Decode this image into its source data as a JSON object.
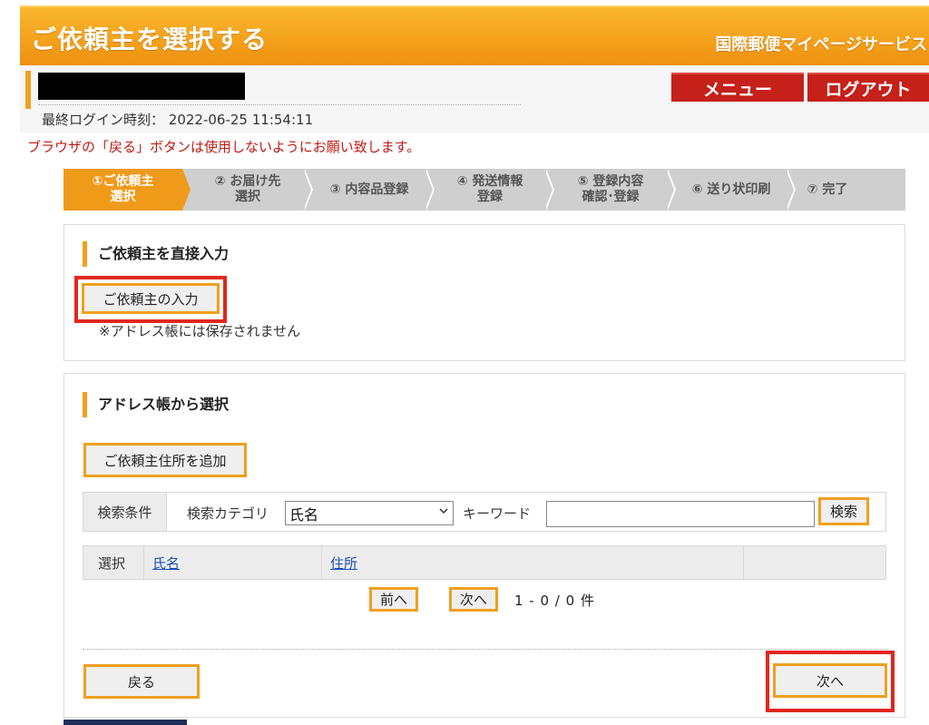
{
  "header": {
    "title": "ご依頼主を選択する",
    "service": "国際郵便マイページサービス"
  },
  "user": {
    "last_login_label": "最終ログイン時刻：",
    "last_login_value": "2022-06-25 11:54:11",
    "menu_label": "メニュー",
    "logout_label": "ログアウト"
  },
  "warning": "ブラウザの「戻る」ボタンは使用しないようにお願い致します。",
  "steps": [
    {
      "line1": "①ご依頼主",
      "line2": "選択"
    },
    {
      "line1": "② お届け先",
      "line2": "選択"
    },
    {
      "line1": "③ 内容品登録",
      "line2": ""
    },
    {
      "line1": "④ 発送情報",
      "line2": "登録"
    },
    {
      "line1": "⑤ 登録内容",
      "line2": "確認･登録"
    },
    {
      "line1": "⑥ 送り状印刷",
      "line2": ""
    },
    {
      "line1": "⑦ 完了",
      "line2": ""
    }
  ],
  "direct": {
    "title": "ご依頼主を直接入力",
    "input_button": "ご依頼主の入力",
    "note": "※アドレス帳には保存されません"
  },
  "address": {
    "title": "アドレス帳から選択",
    "add_button": "ご依頼主住所を追加",
    "search": {
      "label": "検索条件",
      "category_label": "検索カテゴリ",
      "category_value": "氏名",
      "keyword_label": "キーワード",
      "keyword_value": "",
      "search_button": "検索"
    },
    "table": {
      "col_select": "選択",
      "col_name": "氏名",
      "col_address": "住所"
    },
    "paging": {
      "prev": "前へ",
      "next": "次へ",
      "summary": "1 - 0 / 0 件"
    }
  },
  "nav": {
    "back": "戻る",
    "next": "次へ"
  },
  "colors": {
    "accent": "#f0a020",
    "brand_red": "#c5201a",
    "highlight_red": "#e2261c",
    "link": "#1a4fb5"
  }
}
